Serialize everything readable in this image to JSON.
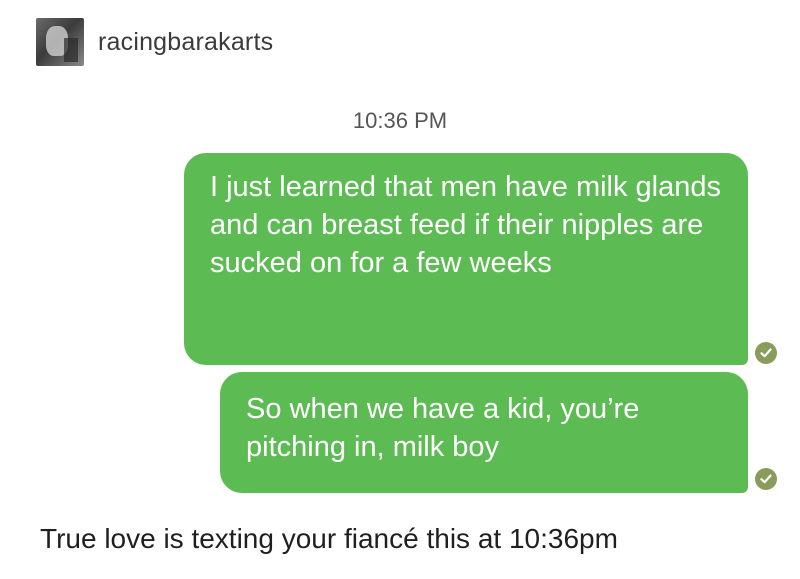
{
  "post": {
    "username": "racingbarakarts",
    "avatar_icon": "user-avatar-photo"
  },
  "conversation": {
    "timestamp": "10:36 PM",
    "messages": [
      {
        "text": "I just learned that men have milk glands and can breast feed if their nipples are sucked on for a few weeks",
        "status": "read-checkmark-icon"
      },
      {
        "text": "So when we have a kid, you’re pitching in, milk boy",
        "status": "read-checkmark-icon"
      }
    ],
    "bubble_color": "#5dbb54"
  },
  "caption": "True love is texting your fiancé this at 10:36pm"
}
